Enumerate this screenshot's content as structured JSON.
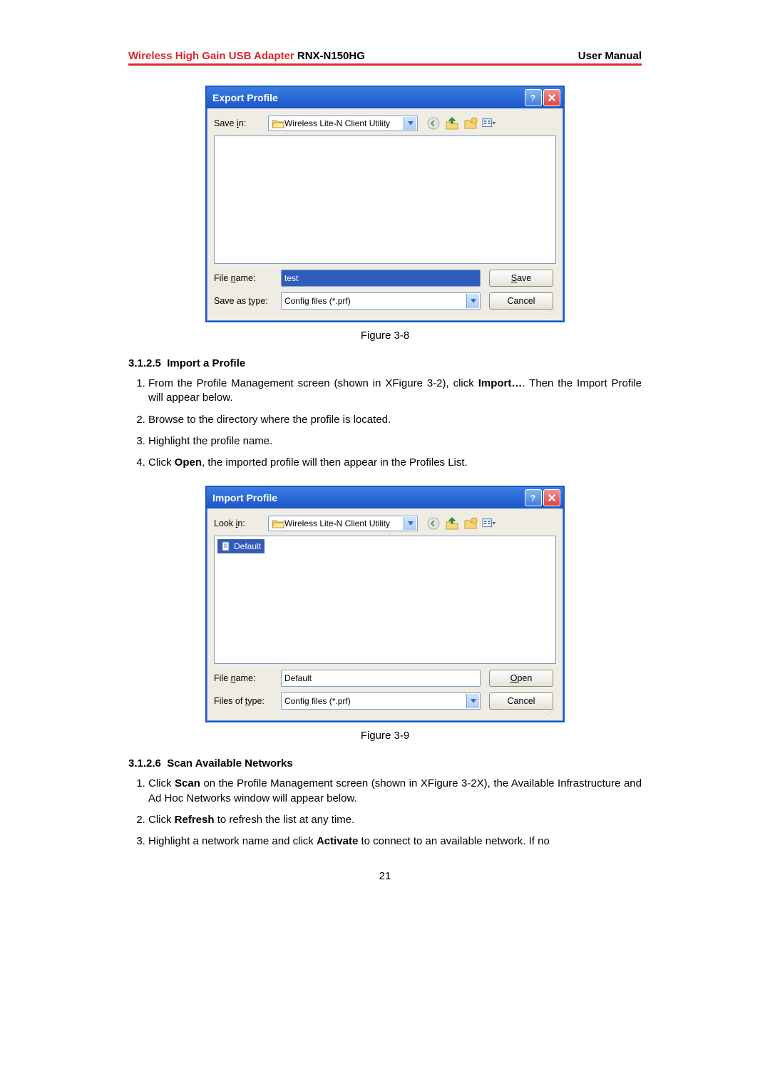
{
  "header": {
    "product_red": "Wireless High Gain USB Adapter",
    "product_model": " RNX-N150HG",
    "right": "User Manual"
  },
  "dialog1": {
    "title": "Export Profile",
    "save_in_label": "Save in:",
    "folder_name": "Wireless Lite-N Client Utility",
    "filename_label": "File name:",
    "filename_value": "test",
    "type_label": "Save as type:",
    "type_value": "Config files (*.prf)",
    "primary_btn": "Save",
    "cancel_btn": "Cancel"
  },
  "caption1": "Figure 3-8",
  "section1": {
    "num": "3.1.2.5",
    "title": "Import a Profile",
    "steps": [
      {
        "pre": "From the Profile Management screen (shown in XFigure 3-2), click ",
        "bold": "Import…",
        "post": ". Then the Import Profile will appear below."
      },
      {
        "pre": "Browse to the directory where the profile is located.",
        "bold": "",
        "post": ""
      },
      {
        "pre": "Highlight the profile name.",
        "bold": "",
        "post": ""
      },
      {
        "pre": "Click ",
        "bold": "Open",
        "post": ", the imported profile will then appear in the Profiles List."
      }
    ]
  },
  "dialog2": {
    "title": "Import Profile",
    "look_in_label": "Look in:",
    "folder_name": "Wireless Lite-N Client Utility",
    "file_item": "Default",
    "filename_label": "File name:",
    "filename_value": "Default",
    "type_label": "Files of type:",
    "type_value": "Config files (*.prf)",
    "primary_btn": "Open",
    "cancel_btn": "Cancel"
  },
  "caption2": "Figure 3-9",
  "section2": {
    "num": "3.1.2.6",
    "title": "Scan Available Networks",
    "steps": [
      {
        "pre": "Click ",
        "bold": "Scan",
        "post": " on the Profile Management screen (shown in XFigure 3-2X), the Available Infrastructure and Ad Hoc Networks window will appear below."
      },
      {
        "pre": "Click ",
        "bold": "Refresh",
        "post": " to refresh the list at any time."
      },
      {
        "pre": "Highlight a network name and click ",
        "bold": "Activate",
        "post": " to connect to an available network. If no"
      }
    ]
  },
  "page_number": "21"
}
